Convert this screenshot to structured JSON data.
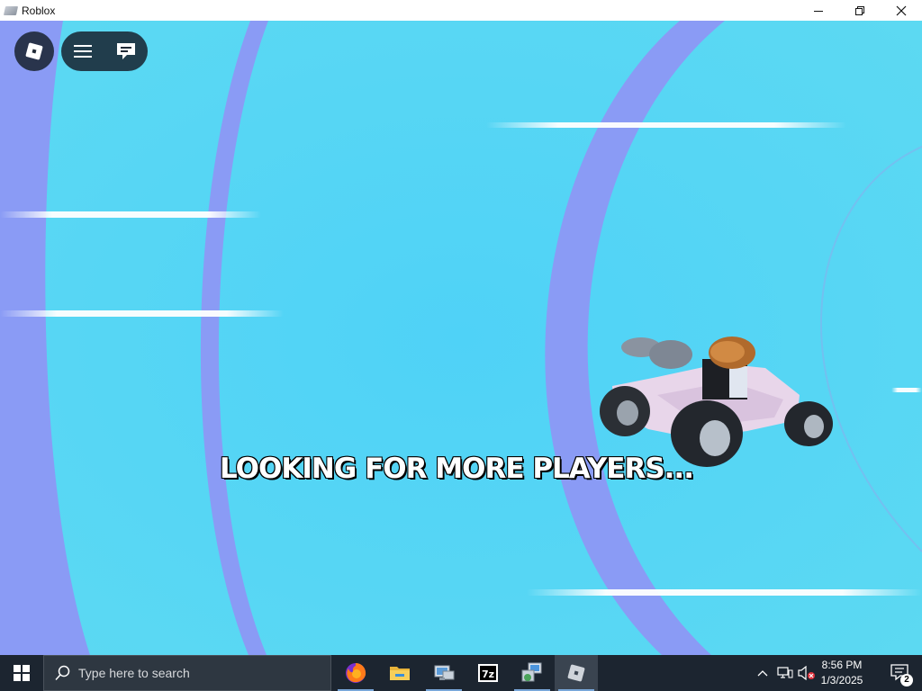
{
  "window": {
    "title": "Roblox",
    "minimize_icon": "minimize-icon",
    "restore_icon": "restore-icon",
    "close_icon": "close-icon"
  },
  "game": {
    "status_text": "LOOKING FOR MORE PLAYERS...",
    "hud": {
      "roblox_menu_icon": "roblox-logo-icon",
      "menu_icon": "hamburger-menu-icon",
      "chat_icon": "chat-icon"
    },
    "colors": {
      "sky": "#56d6f4",
      "ring": "#8a9bf5",
      "hud_bg": "#18222e"
    }
  },
  "taskbar": {
    "search_placeholder": "Type here to search",
    "apps": [
      {
        "name": "Firefox",
        "icon": "firefox-icon"
      },
      {
        "name": "File Explorer",
        "icon": "file-explorer-icon"
      },
      {
        "name": "Network",
        "icon": "network-computer-icon"
      },
      {
        "name": "7-Zip",
        "icon": "7zip-icon",
        "text": "7z"
      },
      {
        "name": "Network Setup",
        "icon": "network-setup-icon"
      },
      {
        "name": "Roblox",
        "icon": "roblox-icon"
      }
    ],
    "tray": {
      "chevron_icon": "chevron-up-icon",
      "network_icon": "network-icon",
      "volume_icon": "volume-muted-icon"
    },
    "clock": {
      "time": "8:56 PM",
      "date": "1/3/2025"
    },
    "notifications": {
      "icon": "notification-icon",
      "count": "2"
    }
  }
}
